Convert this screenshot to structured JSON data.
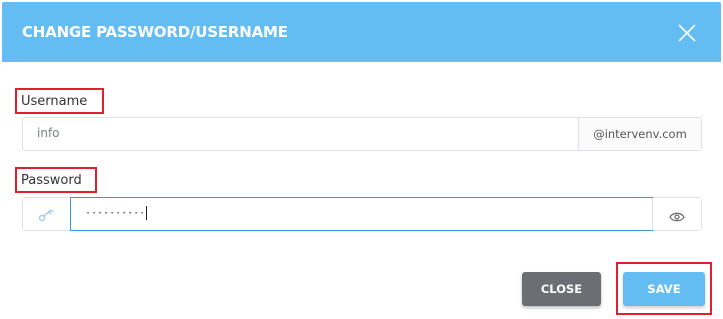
{
  "dialog": {
    "title": "CHANGE PASSWORD/USERNAME",
    "close_icon": "close-x-icon"
  },
  "username": {
    "label": "Username",
    "value": "info",
    "domain_suffix": "@intervenv.com"
  },
  "password": {
    "label": "Password",
    "masked_value": "··········",
    "left_icon": "key-icon",
    "right_icon": "eye-icon"
  },
  "buttons": {
    "close_label": "CLOSE",
    "save_label": "SAVE"
  },
  "colors": {
    "header": "#63bdf3",
    "highlight": "#e0202f",
    "close_button": "#6b6e72",
    "save_button": "#63bdf3"
  }
}
